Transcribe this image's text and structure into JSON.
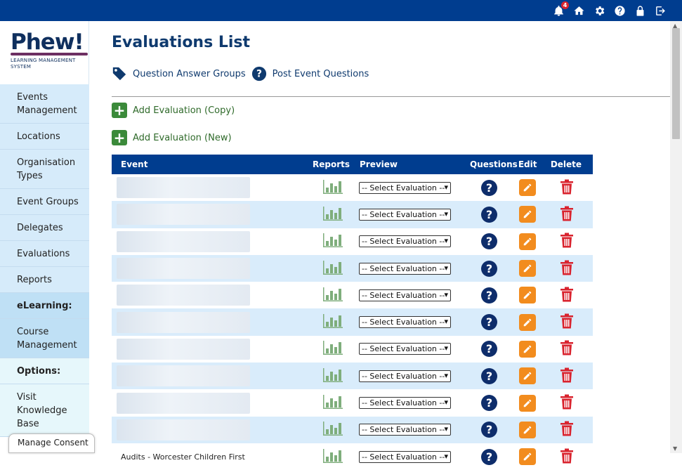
{
  "topbar": {
    "notification_count": "4"
  },
  "logo": {
    "word": "Phew!",
    "subtitle_line1": "LEARNING MANAGEMENT",
    "subtitle_line2": "SYSTEM"
  },
  "sidebar": {
    "items": [
      {
        "label": "Events Management"
      },
      {
        "label": "Locations"
      },
      {
        "label": "Organisation Types"
      },
      {
        "label": "Event Groups"
      },
      {
        "label": "Delegates"
      },
      {
        "label": "Evaluations"
      },
      {
        "label": "Reports"
      },
      {
        "label": "eLearning:"
      },
      {
        "label": "Course Management"
      },
      {
        "label": "Options:"
      },
      {
        "label": "Visit Knowledge Base"
      }
    ]
  },
  "consent": {
    "label": "Manage Consent"
  },
  "page": {
    "title": "Evaluations List",
    "link_qa_groups": "Question Answer Groups",
    "link_post_event": "Post Event Questions",
    "add_copy": "Add Evaluation (Copy)",
    "add_new": "Add Evaluation (New)"
  },
  "table": {
    "headers": {
      "event": "Event",
      "reports": "Reports",
      "preview": "Preview",
      "questions": "Questions",
      "edit": "Edit",
      "delete": "Delete"
    },
    "select_placeholder": "-- Select Evaluation --",
    "partial_row_event": "Audits - Worcester Children First"
  },
  "colors": {
    "primary": "#003d8f",
    "accent_green": "#3b8a3a",
    "edit_orange": "#f28c1e",
    "delete_red": "#d9232e"
  }
}
